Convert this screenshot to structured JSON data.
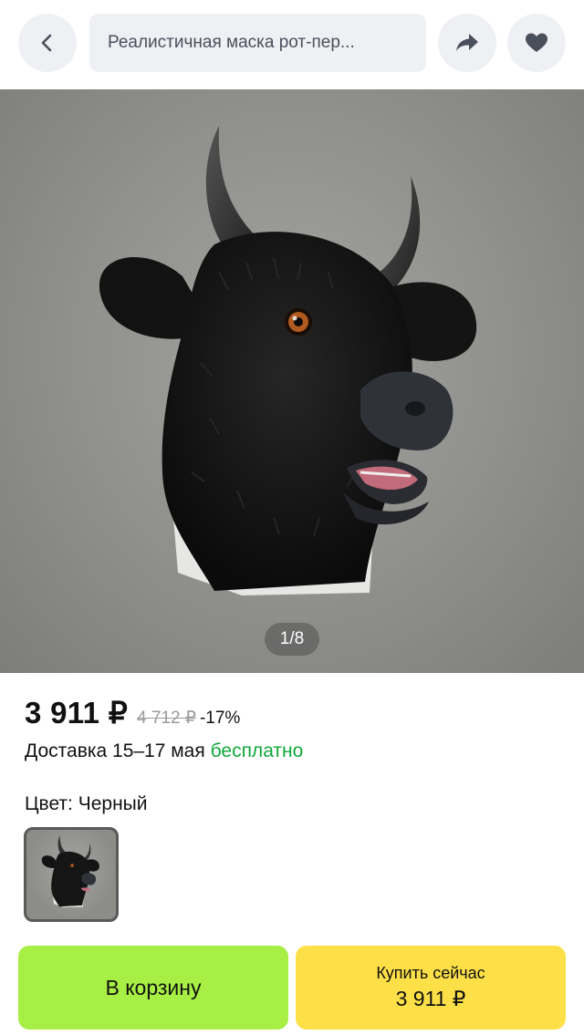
{
  "header": {
    "back_icon": "chevron-left-icon",
    "title": "Реалистичная маска рот-пер...",
    "share_icon": "share-arrow-icon",
    "favorite_icon": "heart-icon"
  },
  "gallery": {
    "counter": "1/8"
  },
  "product": {
    "price": "3 911 ₽",
    "old_price": "4 712 ₽",
    "discount": "-17%",
    "delivery_label": "Доставка 15–17 мая",
    "delivery_free": "бесплатно",
    "color_label": "Цвет: Черный"
  },
  "actions": {
    "cart_label": "В корзину",
    "buy_label": "Купить сейчас",
    "buy_price": "3 911 ₽"
  },
  "colors": {
    "cart_button": "#a7ef44",
    "buy_button": "#fde047",
    "free_delivery": "#10a83a"
  }
}
